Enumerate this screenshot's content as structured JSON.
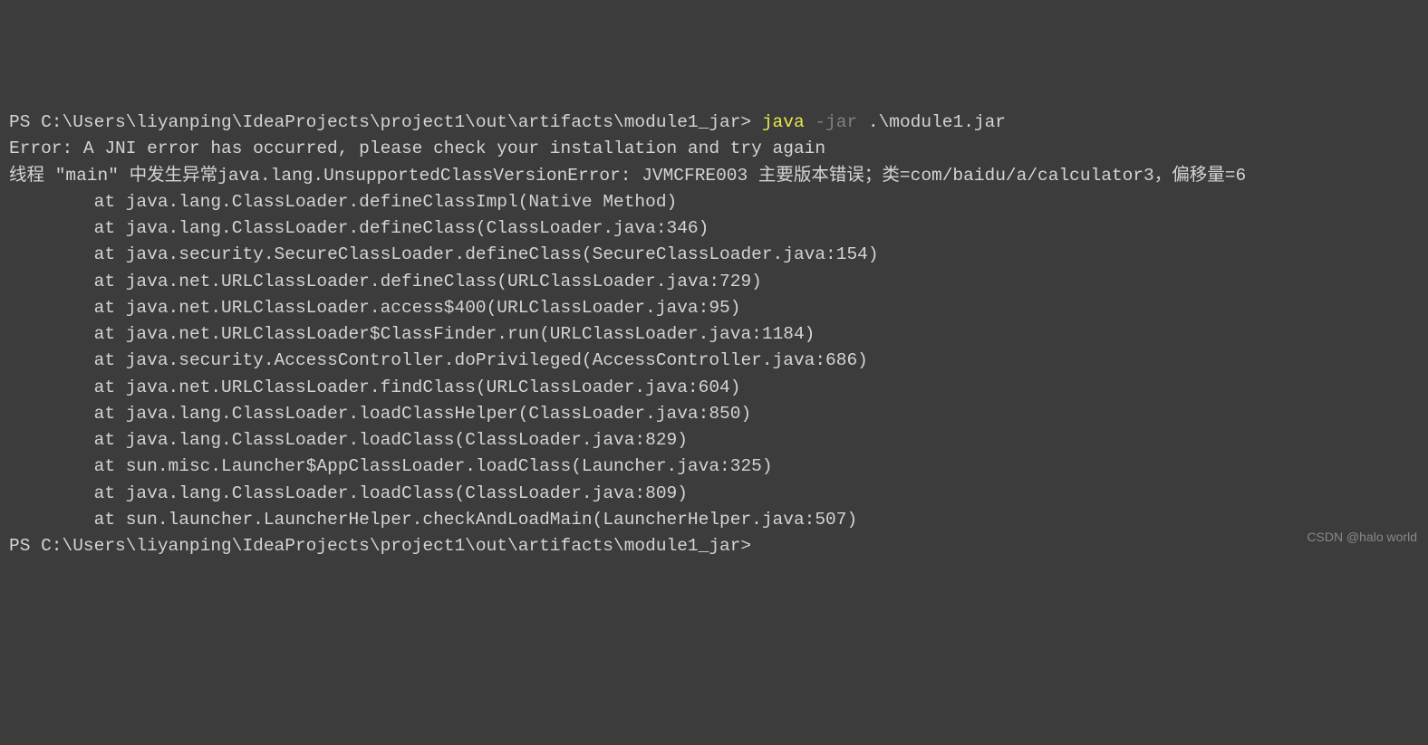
{
  "terminal": {
    "line1": {
      "prompt": "PS C:\\Users\\liyanping\\IdeaProjects\\project1\\out\\artifacts\\module1_jar> ",
      "cmd1": "java",
      "cmd2": " -jar",
      "cmd3": " .\\module1.jar"
    },
    "error1": "Error: A JNI error has occurred, please check your installation and try again",
    "error2": "线程 \"main\" 中发生异常java.lang.UnsupportedClassVersionError: JVMCFRE003 主要版本错误；类=com/baidu/a/calculator3，偏移量=6",
    "stack": [
      "        at java.lang.ClassLoader.defineClassImpl(Native Method)",
      "        at java.lang.ClassLoader.defineClass(ClassLoader.java:346)",
      "        at java.security.SecureClassLoader.defineClass(SecureClassLoader.java:154)",
      "        at java.net.URLClassLoader.defineClass(URLClassLoader.java:729)",
      "        at java.net.URLClassLoader.access$400(URLClassLoader.java:95)",
      "        at java.net.URLClassLoader$ClassFinder.run(URLClassLoader.java:1184)",
      "        at java.security.AccessController.doPrivileged(AccessController.java:686)",
      "        at java.net.URLClassLoader.findClass(URLClassLoader.java:604)",
      "        at java.lang.ClassLoader.loadClassHelper(ClassLoader.java:850)",
      "        at java.lang.ClassLoader.loadClass(ClassLoader.java:829)",
      "        at sun.misc.Launcher$AppClassLoader.loadClass(Launcher.java:325)",
      "        at java.lang.ClassLoader.loadClass(ClassLoader.java:809)",
      "        at sun.launcher.LauncherHelper.checkAndLoadMain(LauncherHelper.java:507)"
    ],
    "prompt2": "PS C:\\Users\\liyanping\\IdeaProjects\\project1\\out\\artifacts\\module1_jar>"
  },
  "watermark": "CSDN @halo world"
}
